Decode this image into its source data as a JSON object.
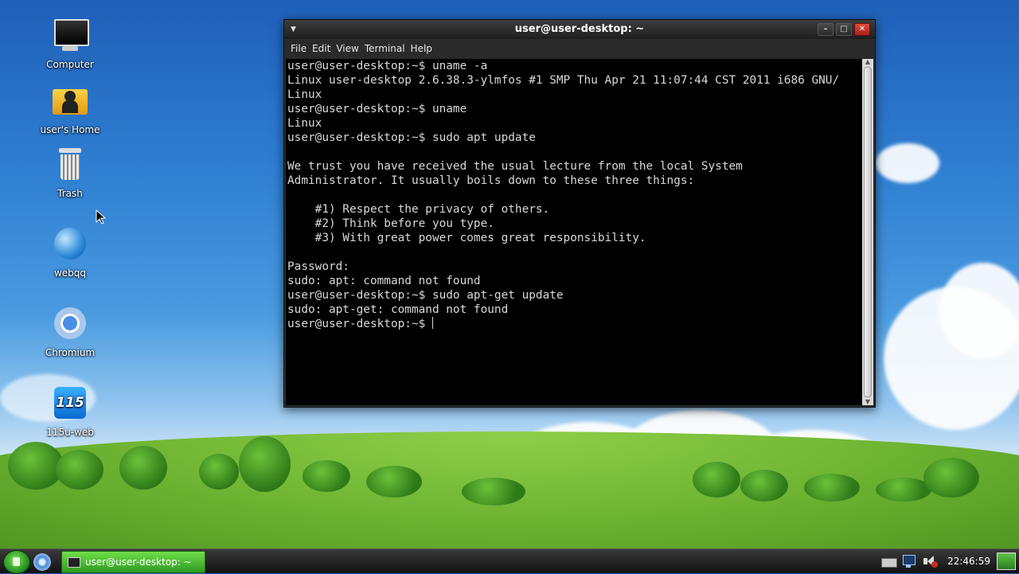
{
  "desktop": {
    "icons": [
      {
        "label": "Computer"
      },
      {
        "label": "user's Home"
      },
      {
        "label": "Trash"
      },
      {
        "label": "webqq"
      },
      {
        "label": "Chromium"
      },
      {
        "label": "115u-web"
      }
    ]
  },
  "terminal": {
    "title": "user@user-desktop: ~",
    "menu": [
      "File",
      "Edit",
      "View",
      "Terminal",
      "Help"
    ],
    "lines": [
      "user@user-desktop:~$ uname -a",
      "Linux user-desktop 2.6.38.3-ylmfos #1 SMP Thu Apr 21 11:07:44 CST 2011 i686 GNU/",
      "Linux",
      "user@user-desktop:~$ uname",
      "Linux",
      "user@user-desktop:~$ sudo apt update",
      "",
      "We trust you have received the usual lecture from the local System",
      "Administrator. It usually boils down to these three things:",
      "",
      "    #1) Respect the privacy of others.",
      "    #2) Think before you type.",
      "    #3) With great power comes great responsibility.",
      "",
      "Password:",
      "sudo: apt: command not found",
      "user@user-desktop:~$ sudo apt-get update",
      "sudo: apt-get: command not found",
      "user@user-desktop:~$ "
    ]
  },
  "taskbar": {
    "task_label": "user@user-desktop: ~",
    "clock": "22:46:59"
  }
}
